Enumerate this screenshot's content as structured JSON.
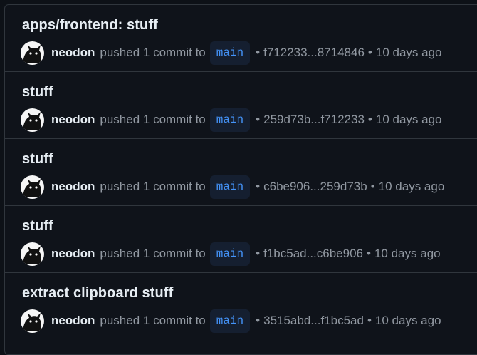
{
  "pushes": [
    {
      "title": "apps/frontend: stuff",
      "user": "neodon",
      "action": "pushed 1 commit to",
      "branch": "main",
      "range": "f712233...8714846",
      "time": "10 days ago"
    },
    {
      "title": "stuff",
      "user": "neodon",
      "action": "pushed 1 commit to",
      "branch": "main",
      "range": "259d73b...f712233",
      "time": "10 days ago"
    },
    {
      "title": "stuff",
      "user": "neodon",
      "action": "pushed 1 commit to",
      "branch": "main",
      "range": "c6be906...259d73b",
      "time": "10 days ago"
    },
    {
      "title": "stuff",
      "user": "neodon",
      "action": "pushed 1 commit to",
      "branch": "main",
      "range": "f1bc5ad...c6be906",
      "time": "10 days ago"
    },
    {
      "title": "extract clipboard stuff",
      "user": "neodon",
      "action": "pushed 1 commit to",
      "branch": "main",
      "range": "3515abd...f1bc5ad",
      "time": "10 days ago"
    }
  ],
  "separator": "•",
  "icons": {
    "avatar": "black-cat-avatar-icon"
  },
  "colors": {
    "background": "#0d1117",
    "border": "#30363d",
    "branch_text": "#4493f8",
    "branch_bg": "#151f30",
    "muted_text": "#9198a1",
    "primary_text": "#e6edf3"
  }
}
